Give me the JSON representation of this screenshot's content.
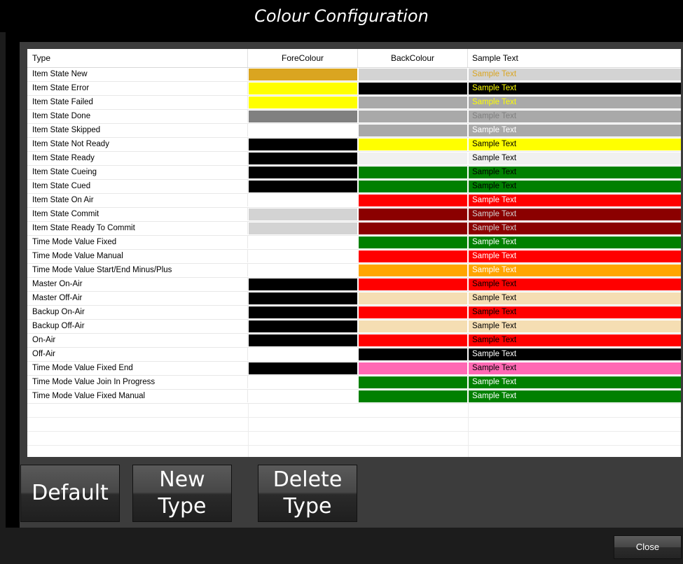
{
  "window": {
    "title": "Colour Configuration"
  },
  "grid": {
    "columns": {
      "type": "Type",
      "fore": "ForeColour",
      "back": "BackColour",
      "sample": "Sample Text"
    },
    "rows": [
      {
        "type": "Item State New",
        "fore": "#DAA520",
        "back": "#D3D3D3",
        "sample": "Sample Text"
      },
      {
        "type": "Item State Error",
        "fore": "#FFFF00",
        "back": "#000000",
        "sample": "Sample Text"
      },
      {
        "type": "Item State Failed",
        "fore": "#FFFF00",
        "back": "#A9A9A9",
        "sample": "Sample Text"
      },
      {
        "type": "Item State Done",
        "fore": "#808080",
        "back": "#A9A9A9",
        "sample": "Sample Text"
      },
      {
        "type": "Item State Skipped",
        "fore": "#FFFFFF",
        "back": "#A9A9A9",
        "sample": "Sample Text"
      },
      {
        "type": "Item State Not Ready",
        "fore": "#000000",
        "back": "#FFFF00",
        "sample": "Sample Text"
      },
      {
        "type": "Item State Ready",
        "fore": "#000000",
        "back": "#F0F0F0",
        "sample": "Sample Text"
      },
      {
        "type": "Item State Cueing",
        "fore": "#000000",
        "back": "#008000",
        "sample": "Sample Text"
      },
      {
        "type": "Item State Cued",
        "fore": "#000000",
        "back": "#008000",
        "sample": "Sample Text"
      },
      {
        "type": "Item State On Air",
        "fore": "#FFFFFF",
        "back": "#FF0000",
        "sample": "Sample Text"
      },
      {
        "type": "Item State Commit",
        "fore": "#D3D3D3",
        "back": "#8B0000",
        "sample": "Sample Text"
      },
      {
        "type": "Item State Ready To Commit",
        "fore": "#D3D3D3",
        "back": "#8B0000",
        "sample": "Sample Text"
      },
      {
        "type": "Time Mode Value Fixed",
        "fore": "#FFFFFF",
        "back": "#008000",
        "sample": "Sample Text"
      },
      {
        "type": "Time Mode Value Manual",
        "fore": "#FFFFFF",
        "back": "#FF0000",
        "sample": "Sample Text"
      },
      {
        "type": "Time Mode Value Start/End Minus/Plus",
        "fore": "#FFFFFF",
        "back": "#FFA500",
        "sample": "Sample Text"
      },
      {
        "type": "Master On-Air",
        "fore": "#000000",
        "back": "#FF0000",
        "sample": "Sample Text"
      },
      {
        "type": "Master Off-Air",
        "fore": "#000000",
        "back": "#F5DEB3",
        "sample": "Sample Text"
      },
      {
        "type": "Backup On-Air",
        "fore": "#000000",
        "back": "#FF0000",
        "sample": "Sample Text"
      },
      {
        "type": "Backup Off-Air",
        "fore": "#000000",
        "back": "#F5DEB3",
        "sample": "Sample Text"
      },
      {
        "type": "On-Air",
        "fore": "#000000",
        "back": "#FF0000",
        "sample": "Sample Text"
      },
      {
        "type": "Off-Air",
        "fore": "#FFFFFF",
        "back": "#000000",
        "sample": "Sample Text"
      },
      {
        "type": "Time Mode Value Fixed End",
        "fore": "#000000",
        "back": "#FF69B4",
        "sample": "Sample Text"
      },
      {
        "type": "Time Mode Value Join In Progress",
        "fore": "#FFFFFF",
        "back": "#008000",
        "sample": "Sample Text"
      },
      {
        "type": "Time Mode Value Fixed Manual",
        "fore": "#FFFFFF",
        "back": "#008000",
        "sample": "Sample Text"
      }
    ]
  },
  "buttons": {
    "default": "Default",
    "new_type": [
      "New",
      "Type"
    ],
    "delete_type": [
      "Delete",
      "Type"
    ],
    "close": "Close"
  }
}
